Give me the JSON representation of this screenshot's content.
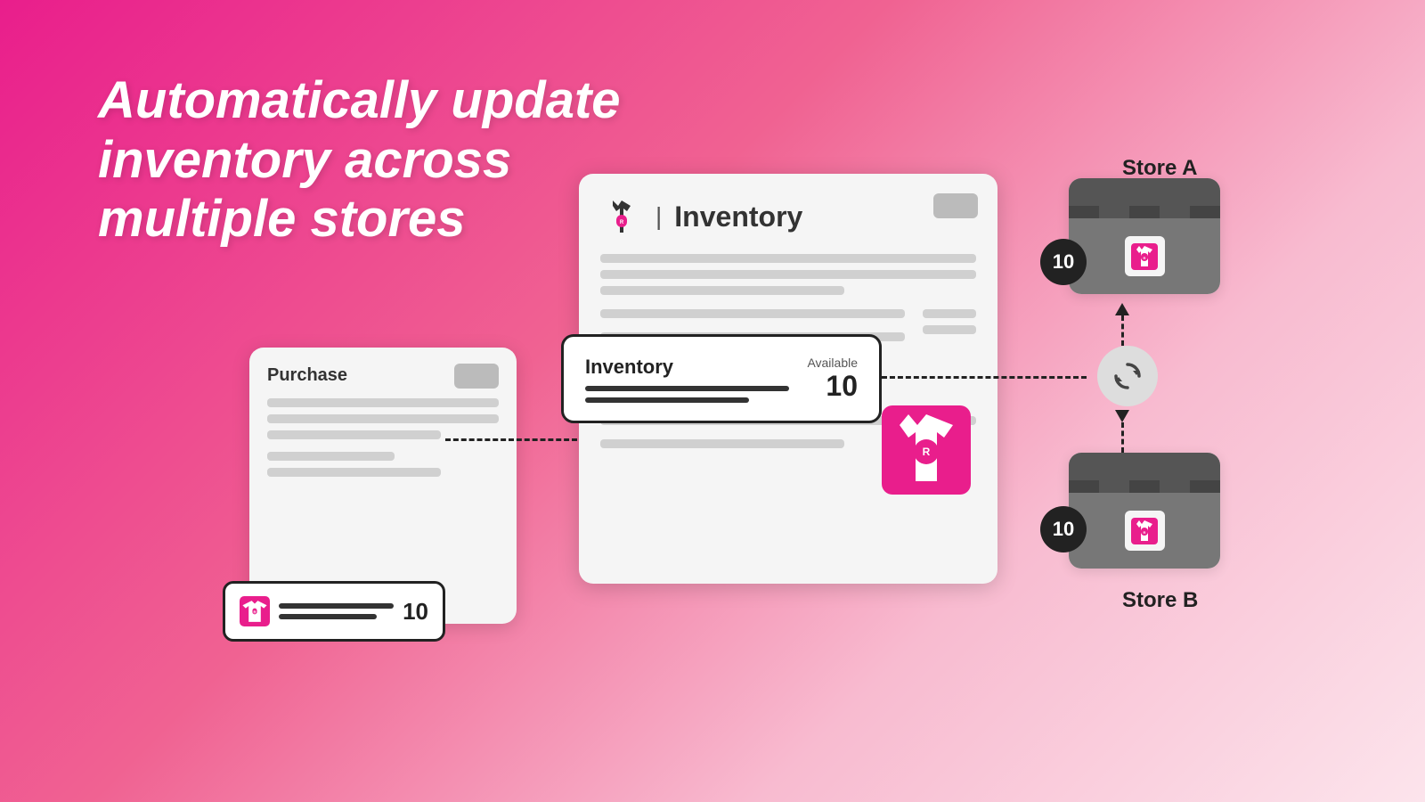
{
  "headline": {
    "line1": "Automatically update inventory across",
    "line2": "multiple stores"
  },
  "purchase_card": {
    "title": "Purchase",
    "quantity": "10"
  },
  "inventory_card": {
    "title": "Inventory",
    "separator": "|"
  },
  "inventory_highlight": {
    "title": "Inventory",
    "available_label": "Available",
    "available_number": "10"
  },
  "purchase_highlight": {
    "quantity": "10"
  },
  "store_a": {
    "label": "Store A",
    "badge": "10"
  },
  "store_b": {
    "label": "Store B",
    "badge": "10"
  },
  "icons": {
    "sync": "🔄",
    "app_logo_char": "R"
  }
}
